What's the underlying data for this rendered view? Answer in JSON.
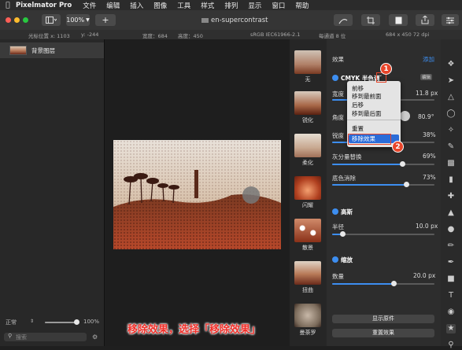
{
  "menubar": {
    "app": "Pixelmator Pro",
    "items": [
      "文件",
      "编辑",
      "插入",
      "图像",
      "工具",
      "样式",
      "排列",
      "显示",
      "窗口",
      "帮助"
    ]
  },
  "toolbar": {
    "zoom": "100%",
    "add": "+",
    "doc_title": "en-supercontrast"
  },
  "infobar": {
    "cursor_x": "光标位置 x:  1103",
    "cursor_y": "y:  -244",
    "width": "宽度：684",
    "height": "高度：450",
    "colorspace": "sRGB IEC61966-2.1",
    "depth": "每通道 8 位",
    "size": "684 x 450 72 dpi"
  },
  "layers": {
    "layer_name": "背景图层",
    "blend_mode": "正常",
    "opacity": "100%",
    "opacity_value": 1.0,
    "search_placeholder": "搜索"
  },
  "effects_browser": {
    "items": [
      "无",
      "锐化",
      "柔化",
      "闪耀",
      "散景",
      "扭曲",
      "曼荼罗"
    ]
  },
  "effects_panel": {
    "header": "效果",
    "add": "添加",
    "effect1_name": "CMYK 半色调",
    "edit_badge": "编辑",
    "width_label": "宽度",
    "width_value": "11.8 px",
    "width_level": 0.3,
    "angle_label": "角度",
    "angle_value": "80.9°",
    "sharp_label": "锐度",
    "sharp_value": "38%",
    "sharp_level": 0.38,
    "gray_label": "灰分量替换",
    "gray_value": "69%",
    "gray_level": 0.69,
    "under_label": "底色消除",
    "under_value": "73%",
    "under_level": 0.73,
    "effect2_name": "高斯",
    "radius_label": "半径",
    "radius_value": "10.0 px",
    "radius_level": 0.1,
    "effect3_name": "缩放",
    "amount_label": "数量",
    "amount_value": "20.0 px",
    "amount_level": 0.6,
    "show_original": "显示原件",
    "reset": "重置效果"
  },
  "context_menu": {
    "items": [
      "前移",
      "移到最前面",
      "后移",
      "移到最后面",
      "重置",
      "移除效果"
    ],
    "disabled": [
      true,
      true,
      false,
      false,
      false,
      false
    ]
  },
  "annotations": {
    "badge1": "1",
    "badge2": "2",
    "caption": "移除效果，选择「移除效果」"
  },
  "colors": {
    "accent": "#3d8ef0",
    "highlight": "#e8452a"
  }
}
